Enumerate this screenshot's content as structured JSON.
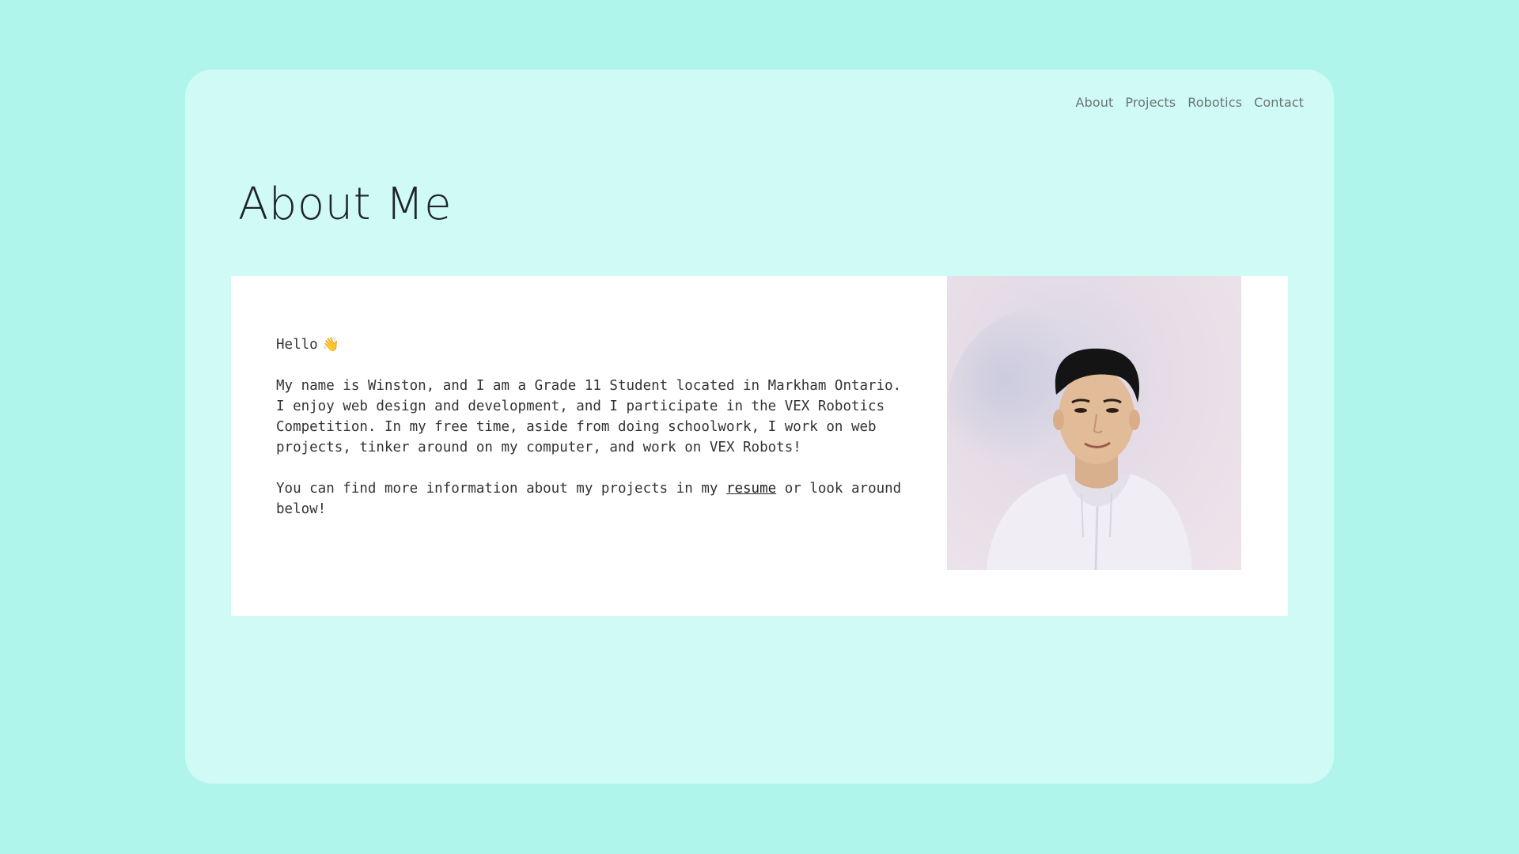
{
  "nav": {
    "items": [
      "About",
      "Projects",
      "Robotics",
      "Contact"
    ]
  },
  "page": {
    "title": "About Me"
  },
  "card": {
    "greeting": "Hello",
    "greeting_emoji": "👋",
    "intro": "My name is Winston, and I am a Grade 11 Student located in Markham Ontario. I enjoy web design and development, and I participate in the VEX Robotics Competition. In my free time, aside from doing schoolwork, I work on web projects, tinker around on my computer, and work on VEX Robots!",
    "more_prefix": "You can find more information about my projects in my",
    "resume_link": "resume",
    "more_suffix": "or look around below!"
  },
  "colors": {
    "background": "#b0f5ec",
    "window": "#d0faf5",
    "card": "#ffffff",
    "text": "#333333",
    "nav_text": "#6b7574"
  }
}
